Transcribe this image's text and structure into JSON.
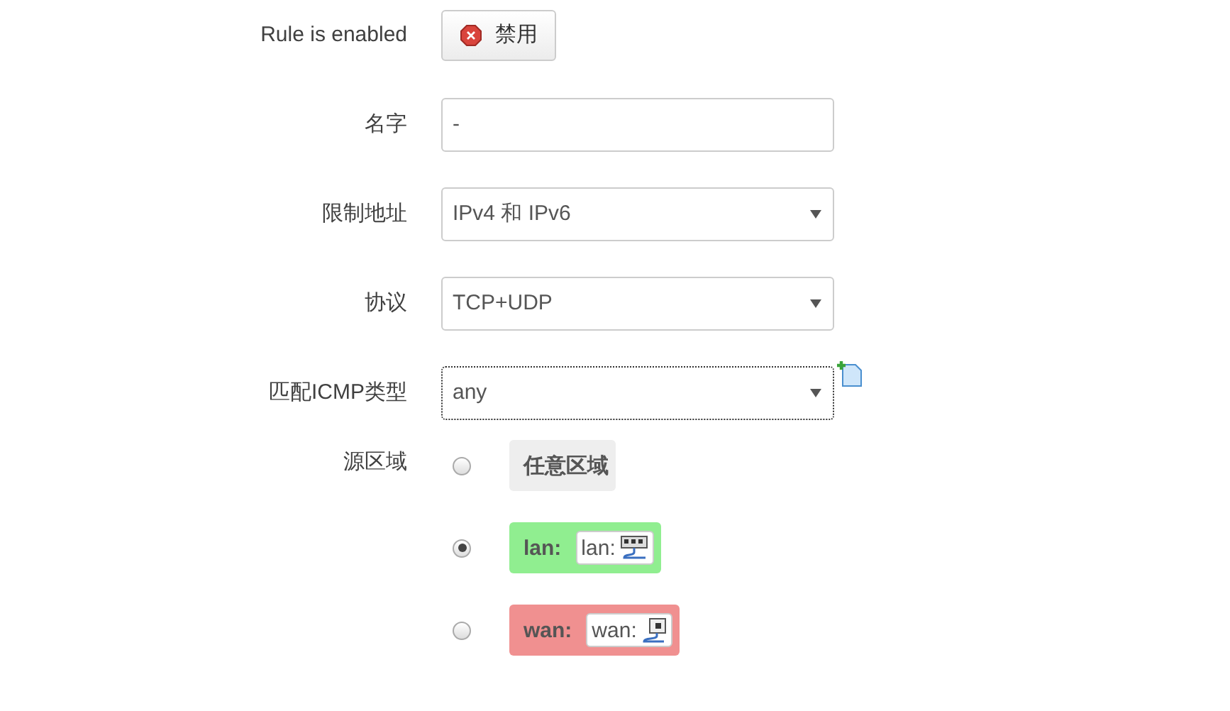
{
  "fields": [
    {
      "kind": "toggle",
      "label": "Rule is enabled",
      "value": "禁用",
      "on": false
    },
    {
      "kind": "text",
      "label": "名字",
      "value": "-"
    },
    {
      "kind": "select",
      "label": "限制地址",
      "value": "IPv4 和 IPv6",
      "focused": false,
      "addable": false
    },
    {
      "kind": "select",
      "label": "协议",
      "value": "TCP+UDP",
      "focused": false,
      "addable": false
    },
    {
      "kind": "select",
      "label": "匹配ICMP类型",
      "value": "any",
      "focused": true,
      "addable": true
    }
  ],
  "source_zone": {
    "label": "源区域",
    "zones": [
      {
        "name": "任意区域",
        "selected": false
      },
      {
        "name": "lan:",
        "selected": true,
        "color": "#90ee90",
        "badge": "lan:"
      },
      {
        "name": "wan:",
        "selected": false,
        "color": "#f09090",
        "badge": "wan:"
      }
    ]
  }
}
